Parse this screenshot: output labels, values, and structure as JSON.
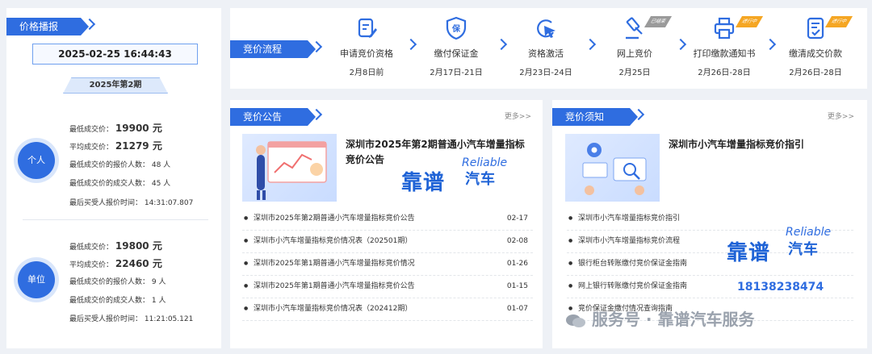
{
  "left": {
    "tag": "价格播报",
    "datetime": "2025-02-25 16:44:43",
    "period": "2025年第2期",
    "personal": {
      "badge": "个人",
      "lowest_label": "最低成交价：",
      "lowest_value": "19900 元",
      "avg_label": "平均成交价：",
      "avg_value": "21279 元",
      "lowest_bidders": "最低成交价的报价人数：  48 人",
      "lowest_deals": "最低成交价的成交人数：  45 人",
      "last_time": "最后买受人报价时间：  14:31:07.807"
    },
    "company": {
      "badge": "单位",
      "lowest_label": "最低成交价：",
      "lowest_value": "19800 元",
      "avg_label": "平均成交价：",
      "avg_value": "22460 元",
      "lowest_bidders": "最低成交价的报价人数：  9 人",
      "lowest_deals": "最低成交价的成交人数：  1 人",
      "last_time": "最后买受人报价时间：  11:21:05.121"
    }
  },
  "process": {
    "tag": "竞价流程",
    "steps": [
      {
        "name": "申请竞价资格",
        "date": "2月8日前",
        "icon": "edit-document-icon"
      },
      {
        "name": "缴付保证金",
        "date": "2月17日-21日",
        "icon": "shield-guarantee-icon"
      },
      {
        "name": "资格激活",
        "date": "2月23日-24日",
        "icon": "cursor-click-icon"
      },
      {
        "name": "网上竞价",
        "date": "2月25日",
        "icon": "gavel-icon",
        "tag": "已结束"
      },
      {
        "name": "打印缴款通知书",
        "date": "2月26日-28日",
        "icon": "printer-icon",
        "tag": "进行中"
      },
      {
        "name": "缴清成交价款",
        "date": "2月26日-28日",
        "icon": "checklist-icon",
        "tag": "进行中"
      }
    ]
  },
  "notice": {
    "tag": "竞价公告",
    "more": "更多>>",
    "headline": "深圳市2025年第2期普通小汽车增量指标竞价公告",
    "items": [
      {
        "title": "深圳市2025年第2期普通小汽车增量指标竞价公告",
        "date": "02-17"
      },
      {
        "title": "深圳市小汽车增量指标竞价情况表（202501期）",
        "date": "02-08"
      },
      {
        "title": "深圳市2025年第1期普通小汽车增量指标竞价情况",
        "date": "01-26"
      },
      {
        "title": "深圳市2025年第1期普通小汽车增量指标竞价公告",
        "date": "01-15"
      },
      {
        "title": "深圳市小汽车增量指标竞价情况表（202412期）",
        "date": "01-07"
      }
    ]
  },
  "guide": {
    "tag": "竞价须知",
    "more": "更多>>",
    "headline": "深圳市小汽车增量指标竞价指引",
    "items": [
      {
        "title": "深圳市小汽车增量指标竞价指引"
      },
      {
        "title": "深圳市小汽车增量指标竞价流程"
      },
      {
        "title": "银行柜台转账缴付竞价保证金指南"
      },
      {
        "title": "网上银行转账缴付竞价保证金指南"
      },
      {
        "title": "竞价保证金缴付情况查询指南"
      }
    ]
  },
  "watermark": {
    "brand_cn": "靠谱",
    "brand_en": "Reliable",
    "brand_cn2": "汽车",
    "phone": "18138238474",
    "footer": "服务号 · 靠谱汽车服务"
  },
  "colors": {
    "primary": "#2f6de0",
    "badge_ring": "#d9e6fb",
    "tag_ended": "#9a9a9a",
    "tag_ongoing": "#f5a623"
  }
}
